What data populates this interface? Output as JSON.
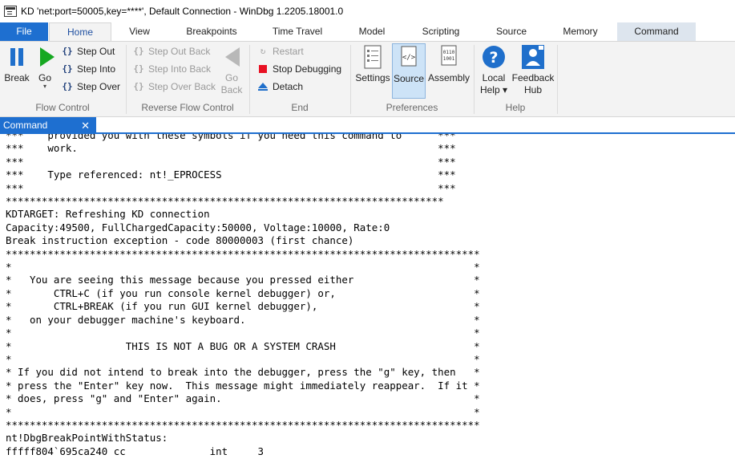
{
  "window": {
    "title": "KD 'net:port=50005,key=****', Default Connection  - WinDbg 1.2205.18001.0"
  },
  "tabs": [
    "File",
    "Home",
    "View",
    "Breakpoints",
    "Time Travel",
    "Model",
    "Scripting",
    "Source",
    "Memory",
    "Command"
  ],
  "ribbon": {
    "flow_control": {
      "label": "Flow Control",
      "break": "Break",
      "go": "Go",
      "step_out": "Step Out",
      "step_into": "Step Into",
      "step_over": "Step Over"
    },
    "reverse_flow_control": {
      "label": "Reverse Flow Control",
      "step_out_back": "Step Out Back",
      "step_into_back": "Step Into Back",
      "step_over_back": "Step Over Back",
      "go_back_line1": "Go",
      "go_back_line2": "Back"
    },
    "end": {
      "label": "End",
      "restart": "Restart",
      "stop_debugging": "Stop Debugging",
      "detach": "Detach"
    },
    "preferences": {
      "label": "Preferences",
      "settings": "Settings",
      "source": "Source",
      "assembly": "Assembly"
    },
    "help": {
      "label": "Help",
      "local_help_line1": "Local",
      "local_help_line2": "Help ▾",
      "feedback_hub_line1": "Feedback",
      "feedback_hub_line2": "Hub"
    }
  },
  "pane": {
    "title": "Command",
    "close": "✕"
  },
  "console": {
    "lines": [
      "***    provided you with these symbols if you need this command to      ***",
      "***    work.                                                            ***",
      "***                                                                     ***",
      "***    Type referenced: nt!_EPROCESS                                    ***",
      "***                                                                     ***",
      "*************************************************************************",
      "KDTARGET: Refreshing KD connection",
      "Capacity:49500, FullChargedCapacity:50000, Voltage:10000, Rate:0",
      "Break instruction exception - code 80000003 (first chance)",
      "*******************************************************************************",
      "*                                                                             *",
      "*   You are seeing this message because you pressed either                    *",
      "*       CTRL+C (if you run console kernel debugger) or,                       *",
      "*       CTRL+BREAK (if you run GUI kernel debugger),                          *",
      "*   on your debugger machine's keyboard.                                      *",
      "*                                                                             *",
      "*                   THIS IS NOT A BUG OR A SYSTEM CRASH                       *",
      "*                                                                             *",
      "* If you did not intend to break into the debugger, press the \"g\" key, then   *",
      "* press the \"Enter\" key now.  This message might immediately reappear.  If it *",
      "* does, press \"g\" and \"Enter\" again.                                          *",
      "*                                                                             *",
      "*******************************************************************************",
      "nt!DbgBreakPointWithStatus:",
      "fffff804`695ca240 cc              int     3"
    ]
  },
  "colors": {
    "accent": "#1e6fd0",
    "ribbon_bg": "#f3f3f3",
    "selected_bg": "#cde3f7",
    "stop_red": "#e81123",
    "go_green": "#16a821",
    "help_blue": "#1f6fcb"
  }
}
